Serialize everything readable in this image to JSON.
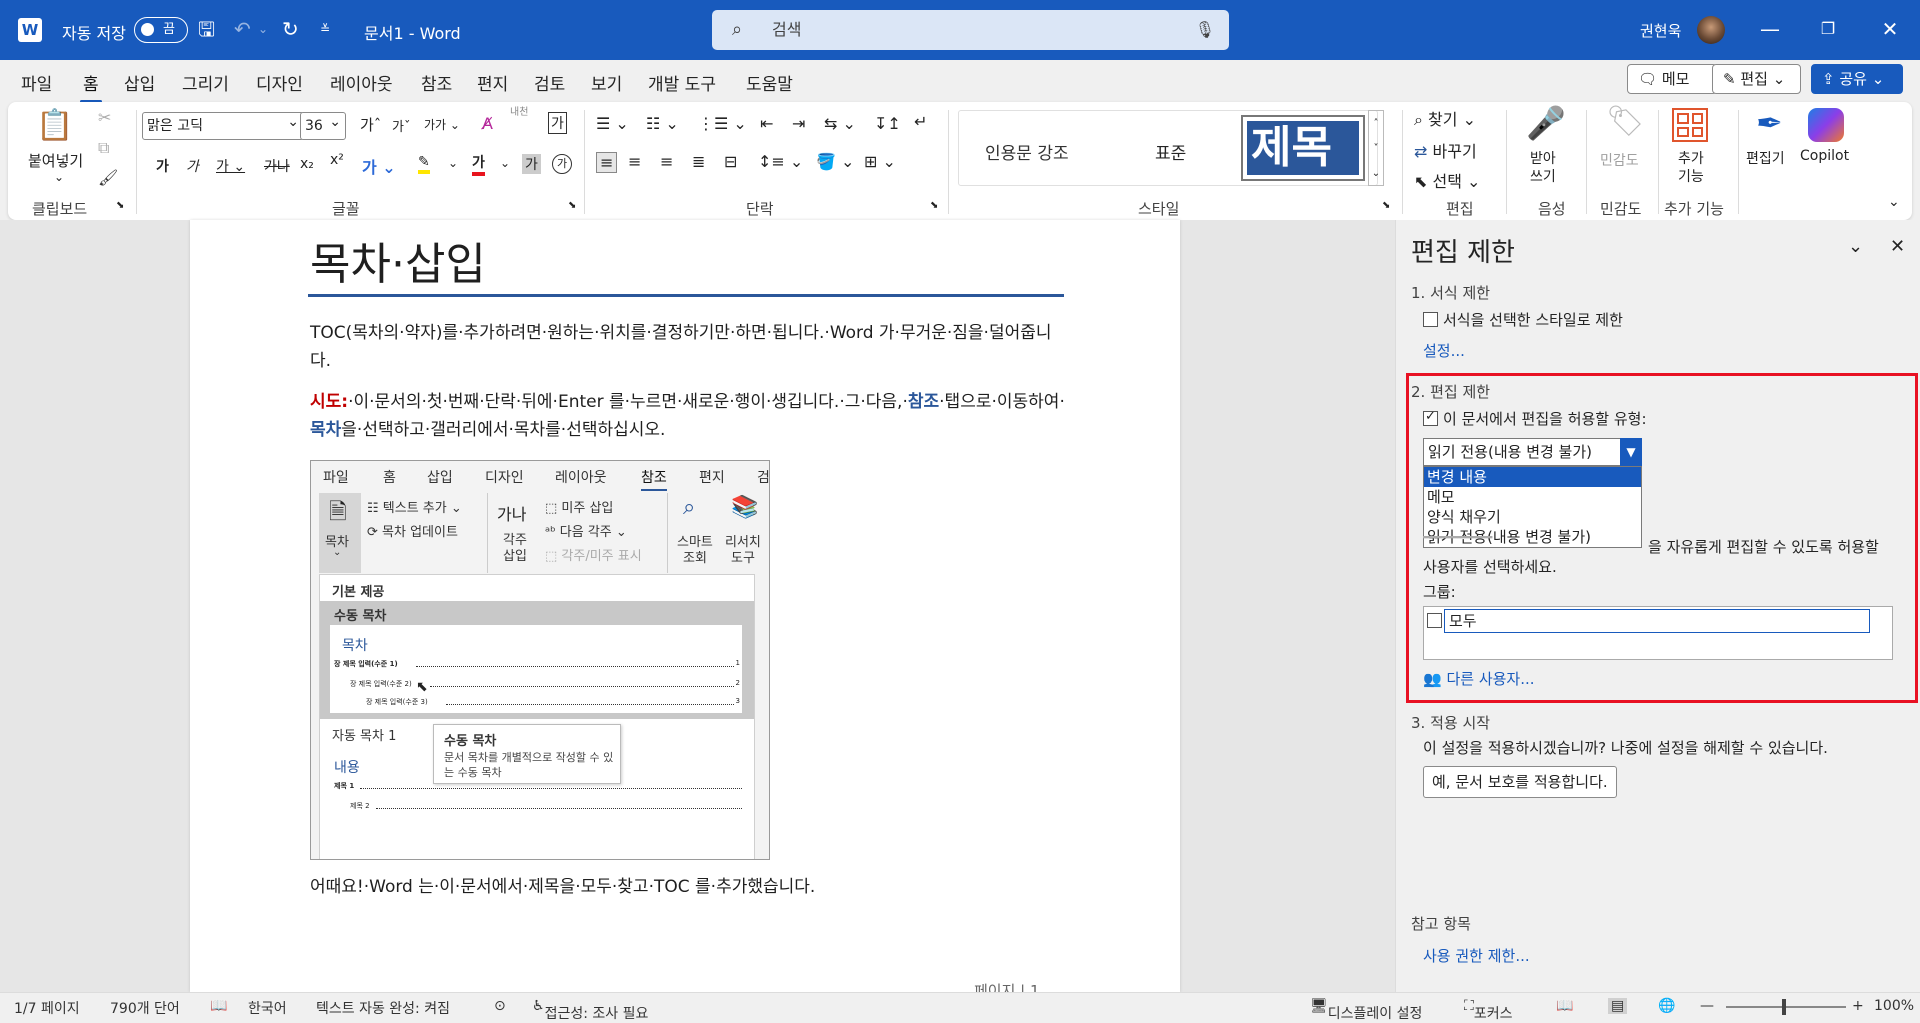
{
  "titlebar": {
    "logo": "W",
    "autosave_label": "자동 저장",
    "autosave_state": "끔",
    "doc_title": "문서1 - Word",
    "search_placeholder": "검색",
    "user_name": "권현욱",
    "icons": [
      "save-icon",
      "undo-icon",
      "redo-icon",
      "customize-icon",
      "minimize-icon",
      "restore-icon",
      "close-icon"
    ]
  },
  "menu": {
    "tabs": [
      "파일",
      "홈",
      "삽입",
      "그리기",
      "디자인",
      "레이아웃",
      "참조",
      "편지",
      "검토",
      "보기",
      "개발 도구",
      "도움말"
    ],
    "active_tab": "홈",
    "memo_btn": "메모",
    "edit_btn": "편집",
    "share_btn": "공유"
  },
  "ribbon": {
    "clipboard": {
      "paste": "붙여넣기",
      "label": "클립보드"
    },
    "font": {
      "name": "맑은 고딕",
      "size": "36",
      "label": "글꼴",
      "hanja": "내천",
      "charbox": "가"
    },
    "paragraph": {
      "label": "단락"
    },
    "styles": {
      "items": [
        "인용문 강조",
        "표준",
        "제목"
      ],
      "label": "스타일"
    },
    "editing": {
      "find": "찾기",
      "replace": "바꾸기",
      "select": "선택",
      "label": "편집"
    },
    "voice": {
      "dictate": "받아\n쓰기",
      "label": "음성"
    },
    "sensitivity": {
      "btn": "민감도",
      "label": "민감도"
    },
    "addins": {
      "btn": "추가\n기능",
      "label": "추가 기능"
    },
    "editor": "편집기",
    "copilot": "Copilot"
  },
  "document": {
    "title": "목차·삽입",
    "para1": "TOC(목차의·약자)를·추가하려면·원하는·위치를·결정하기만·하면·됩니다.·Word 가·무거운·짐을·덜어줍니다.",
    "para2_prefix": "시도:",
    "para2_a": "·이·문서의·첫·번째·단락·뒤에·Enter 를·누르면·새로운·행이·생깁니다.·그·다음,·",
    "para2_ref": "참조",
    "para2_b": "·탭으로·이동하여·",
    "para2_toc": "목차",
    "para2_c": "을·선택하고·갤러리에서·목차를·선택하십시오.",
    "para3": "어때요!·Word 는·이·문서에서·제목을·모두·찾고·TOC 를·추가했습니다.",
    "page_footer": "페이지 | 1",
    "embedded": {
      "tabs": [
        "파일",
        "홈",
        "삽입",
        "디자인",
        "레이아웃",
        "참조",
        "편지",
        "검"
      ],
      "active_tab": "참조",
      "toc_btn": "목차",
      "add_text": "텍스트 추가",
      "update_toc": "목차 업데이트",
      "footnote_big": "가나",
      "footnote_label": "각주\n삽입",
      "endnote": "미주 삽입",
      "next_fn": "다음 각주",
      "show_notes": "각주/미주 표시",
      "smart": "스마트\n조회",
      "research": "리서치\n도구",
      "gallery_header": "기본 제공",
      "manual_toc": "수동 목차",
      "toc_heading": "목차",
      "toc_lines": [
        "장 제목 입력(수준 1)",
        "장 제목 입력(수준 2)",
        "장 제목 입력(수준 3)"
      ],
      "toc_pages": [
        "1",
        "2",
        "3"
      ],
      "auto_toc": "자동 목차 1",
      "content_heading": "내용",
      "content_lines": [
        "제목 1",
        "제목 2"
      ],
      "tooltip_title": "수동 목차",
      "tooltip_text": "문서 목차를 개별적으로 작성할 수 있는 수동 목차"
    }
  },
  "pane": {
    "title": "편집 제한",
    "sec1": "1. 서식 제한",
    "format_check": "서식을 선택한 스타일로 제한",
    "settings_link": "설정...",
    "sec2": "2. 편집 제한",
    "allow_check": "이 문서에서 편집을 허용할 유형:",
    "dropdown_value": "읽기 전용(내용 변경 불가)",
    "dropdown_options": [
      "변경 내용",
      "메모",
      "양식 채우기",
      "읽기 전용(내용 변경 불가)"
    ],
    "dropdown_selected": "변경 내용",
    "exceptions_text": "을 자유롭게 편집할 수 있도록 허용할",
    "exceptions_text2": "사용자를 선택하세요.",
    "groups_label": "그룹:",
    "everyone": "모두",
    "more_users": "다른 사용자...",
    "sec3": "3. 적용 시작",
    "apply_question": "이 설정을 적용하시겠습니까? 나중에 설정을 해제할 수 있습니다.",
    "apply_btn": "예, 문서 보호를 적용합니다.",
    "see_also": "참고 항목",
    "permission_link": "사용 권한 제한..."
  },
  "status": {
    "page": "1/7 페이지",
    "words": "790개 단어",
    "language": "한국어",
    "autocomplete": "텍스트 자동 완성: 켜짐",
    "accessibility": "접근성: 조사 필요",
    "display": "디스플레이 설정",
    "focus": "포커스",
    "zoom": "100%"
  }
}
